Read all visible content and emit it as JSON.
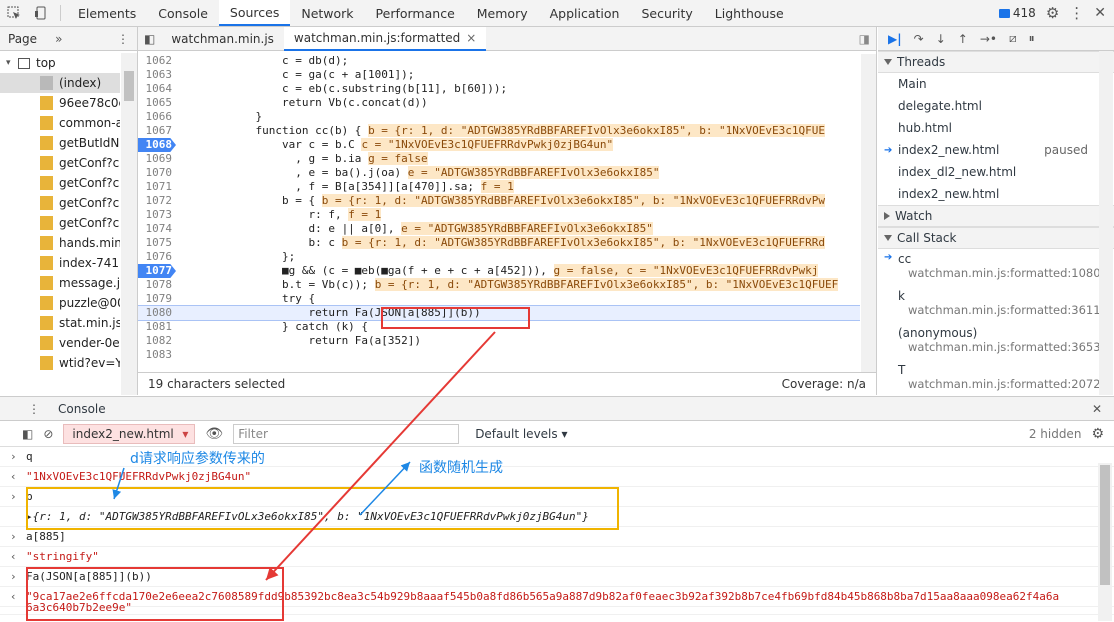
{
  "tabs": [
    "Elements",
    "Console",
    "Sources",
    "Network",
    "Performance",
    "Memory",
    "Application",
    "Security",
    "Lighthouse"
  ],
  "active_tab": "Sources",
  "message_count": "418",
  "navigator": {
    "tab": "Page",
    "items": [
      {
        "label": "top",
        "type": "page",
        "indent": 0
      },
      {
        "label": "(index)",
        "type": "grey",
        "indent": 1,
        "selected": true
      },
      {
        "label": "96ee78c0c",
        "type": "file",
        "indent": 1
      },
      {
        "label": "common-a",
        "type": "file",
        "indent": 1
      },
      {
        "label": "getButIdN",
        "type": "file",
        "indent": 1
      },
      {
        "label": "getConf?c",
        "type": "file",
        "indent": 1
      },
      {
        "label": "getConf?c",
        "type": "file",
        "indent": 1
      },
      {
        "label": "getConf?c",
        "type": "file",
        "indent": 1
      },
      {
        "label": "getConf?c",
        "type": "file",
        "indent": 1
      },
      {
        "label": "hands.min",
        "type": "file",
        "indent": 1
      },
      {
        "label": "index-741",
        "type": "file",
        "indent": 1
      },
      {
        "label": "message.js",
        "type": "file",
        "indent": 1
      },
      {
        "label": "puzzle@00",
        "type": "file",
        "indent": 1
      },
      {
        "label": "stat.min.js",
        "type": "file",
        "indent": 1
      },
      {
        "label": "vender-0e",
        "type": "file",
        "indent": 1
      },
      {
        "label": "wtid?ev=Y",
        "type": "file",
        "indent": 1
      }
    ]
  },
  "editor": {
    "tabs": [
      "watchman.min.js",
      "watchman.min.js:formatted"
    ],
    "status_left": "19 characters selected",
    "status_right": "Coverage: n/a",
    "lines": [
      {
        "n": "1062",
        "code": "                c = db(d);",
        "inline": ""
      },
      {
        "n": "1063",
        "code": "                c = ga(c + a[1001]);",
        "inline": ""
      },
      {
        "n": "1064",
        "code": "                c = eb(c.substring(b[11], b[60]));",
        "inline": ""
      },
      {
        "n": "1065",
        "code": "                return Vb(c.concat(d))",
        "inline": ""
      },
      {
        "n": "1066",
        "code": "            }",
        "inline": ""
      },
      {
        "n": "1067",
        "code": "            function cc(b) { ",
        "inline": "b = {r: 1, d: \"ADTGW385YRdBBFAREFIvOlx3e6okxI85\", b: \"1NxVOEvE3c1QFUE"
      },
      {
        "n": "1068",
        "code": "                var c = b.C ",
        "inline": "c = \"1NxVOEvE3c1QFUEFRRdvPwkj0zjBG4un\"",
        "bp": true
      },
      {
        "n": "1069",
        "code": "                  , g = b.ia ",
        "inline": "g = false"
      },
      {
        "n": "1070",
        "code": "                  , e = ba().j(oa) ",
        "inline": "e = \"ADTGW385YRdBBFAREFIvOlx3e6okxI85\""
      },
      {
        "n": "1071",
        "code": "                  , f = B[a[354]][a[470]].sa; ",
        "inline": "f = 1"
      },
      {
        "n": "1072",
        "code": "                b = { ",
        "inline": "b = {r: 1, d: \"ADTGW385YRdBBFAREFIvOlx3e6okxI85\", b: \"1NxVOEvE3c1QFUEFRRdvPw"
      },
      {
        "n": "1073",
        "code": "                    r: f, ",
        "inline": "f = 1"
      },
      {
        "n": "1074",
        "code": "                    d: e || a[0], ",
        "inline": "e = \"ADTGW385YRdBBFAREFIvOlx3e6okxI85\""
      },
      {
        "n": "1075",
        "code": "                    b: c ",
        "inline": "b = {r: 1, d: \"ADTGW385YRdBBFAREFIvOlx3e6okxI85\", b: \"1NxVOEvE3c1QFUEFRRd"
      },
      {
        "n": "1076",
        "code": "                };",
        "inline": ""
      },
      {
        "n": "1077",
        "code": "                ■g && (c = ■eb(■ga(f + e + c + a[452])), ",
        "inline": "g = false, c = \"1NxVOEvE3c1QFUEFRRdvPwkj",
        "bp": true
      },
      {
        "n": "1078",
        "code": "                b.t = Vb(c)); ",
        "inline": "b = {r: 1, d: \"ADTGW385YRdBBFAREFIvOlx3e6okxI85\", b: \"1NxVOEvE3c1QFUEF"
      },
      {
        "n": "1079",
        "code": "                try {",
        "inline": ""
      },
      {
        "n": "1080",
        "code": "                    return Fa(JSON[a[885]](b))",
        "inline": "",
        "current": true
      },
      {
        "n": "1081",
        "code": "                } catch (k) {",
        "inline": ""
      },
      {
        "n": "1082",
        "code": "                    return Fa(a[352])",
        "inline": ""
      },
      {
        "n": "1083",
        "code": "",
        "inline": ""
      }
    ]
  },
  "sidebar": {
    "threads_label": "Threads",
    "threads": [
      {
        "name": "Main",
        "status": ""
      },
      {
        "name": "delegate.html",
        "status": ""
      },
      {
        "name": "hub.html",
        "status": ""
      },
      {
        "name": "index2_new.html",
        "status": "paused",
        "current": true
      },
      {
        "name": "index_dl2_new.html",
        "status": ""
      },
      {
        "name": "index2_new.html",
        "status": ""
      }
    ],
    "watch_label": "Watch",
    "callstack_label": "Call Stack",
    "frames": [
      {
        "fn": "cc",
        "loc": "watchman.min.js:formatted:1080",
        "current": true
      },
      {
        "fn": "k",
        "loc": "watchman.min.js:formatted:3611"
      },
      {
        "fn": "(anonymous)",
        "loc": "watchman.min.js:formatted:3653"
      },
      {
        "fn": "T",
        "loc": "watchman.min.js:formatted:2072"
      }
    ]
  },
  "console": {
    "tab": "Console",
    "context": "index2_new.html",
    "filter_placeholder": "Filter",
    "levels": "Default levels ▾",
    "hidden": "2 hidden",
    "lines": [
      {
        "kind": "in",
        "text": "q"
      },
      {
        "kind": "out",
        "text": "\"1NxVOEvE3c1QFUEFRRdvPwkj0zjBG4un\""
      },
      {
        "kind": "in",
        "text": "b"
      },
      {
        "kind": "obj",
        "text": "▸{r: 1, d: \"ADTGW385YRdBBFAREFIvOLx3e6okxI85\", b: \"1NxVOEvE3c1QFUEFRRdvPwkj0zjBG4un\"}"
      },
      {
        "kind": "in",
        "text": "a[885]"
      },
      {
        "kind": "out",
        "text": "\"stringify\""
      },
      {
        "kind": "in",
        "text": "Fa(JSON[a[885]](b))"
      },
      {
        "kind": "out",
        "text": "\"9ca17ae2e6ffcda170e2e6eea2c7608589fdd9b85392bc8ea3c54b929b8aaaf545b0a8fd86b565a9a887d9b82af0feaec3b92af392b8b7ce4fb69bfd84b45b868b8ba7d15aa8aaa098ea62f4a6a"
      },
      {
        "kind": "cont",
        "text": "6a3c640b7b2ee9e\""
      }
    ]
  },
  "annotations": {
    "note1": "d请求响应参数传来的",
    "note2": "函数随机生成"
  },
  "colors": {
    "accent": "#1a73e8",
    "annotation_red": "#e53935",
    "annotation_orange": "#f0b400",
    "annotation_blue": "#1e88e5"
  }
}
